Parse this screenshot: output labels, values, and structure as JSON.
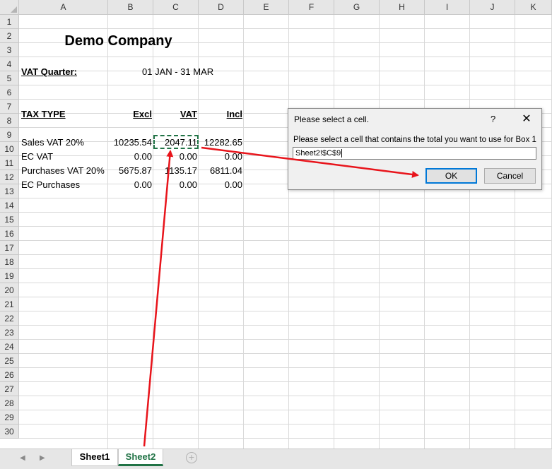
{
  "columns": [
    "A",
    "B",
    "C",
    "D",
    "E",
    "F",
    "G",
    "H",
    "I",
    "J",
    "K"
  ],
  "rows": [
    "1",
    "2",
    "3",
    "4",
    "5",
    "6",
    "7",
    "8",
    "9",
    "10",
    "11",
    "12",
    "13",
    "14",
    "15",
    "16",
    "17",
    "18",
    "19",
    "20",
    "21",
    "22",
    "23",
    "24",
    "25",
    "26",
    "27",
    "28",
    "29",
    "30"
  ],
  "sheet": {
    "company": "Demo Company",
    "vat_quarter_label": "VAT Quarter:",
    "vat_quarter_value": "01 JAN - 31 MAR",
    "headers": {
      "tax_type": "TAX TYPE",
      "excl": "Excl",
      "vat": "VAT",
      "incl": "Incl"
    },
    "table": [
      {
        "type": "Sales VAT 20%",
        "excl": "10235.54",
        "vat": "2047.11",
        "incl": "12282.65"
      },
      {
        "type": "EC VAT",
        "excl": "0.00",
        "vat": "0.00",
        "incl": "0.00"
      },
      {
        "type": "Purchases VAT 20%",
        "excl": "5675.87",
        "vat": "1135.17",
        "incl": "6811.04"
      },
      {
        "type": "EC Purchases",
        "excl": "0.00",
        "vat": "0.00",
        "incl": "0.00"
      }
    ]
  },
  "dialog": {
    "title": "Please select a cell.",
    "help": "?",
    "close": "✕",
    "prompt": "Please select a cell that contains the total you want to use for Box 1",
    "input_value": "Sheet2!$C$9",
    "ok_label": "OK",
    "cancel_label": "Cancel"
  },
  "tabs": {
    "prev_icon": "◀",
    "next_icon": "▶",
    "items": [
      "Sheet1",
      "Sheet2"
    ],
    "active": "Sheet2",
    "add_icon": "+"
  },
  "colors": {
    "accent": "#217346",
    "annotation": "#e8141b",
    "focus": "#0078d7"
  }
}
